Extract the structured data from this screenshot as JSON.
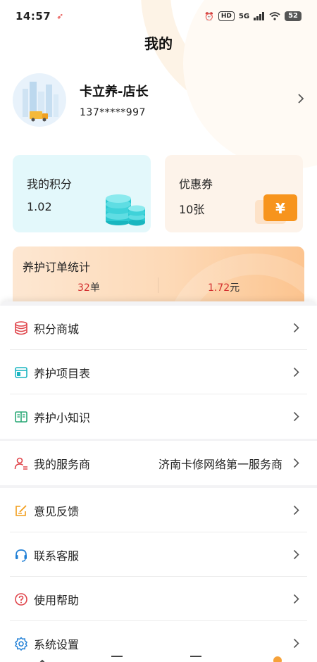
{
  "status_bar": {
    "time": "14:57",
    "hd_label": "HD",
    "network": "5G",
    "battery": "52"
  },
  "header": {
    "title": "我的"
  },
  "profile": {
    "name": "卡立养-店长",
    "phone": "137*****997"
  },
  "cards": {
    "points": {
      "label": "我的积分",
      "value": "1.02"
    },
    "coupon": {
      "label": "优惠券",
      "value": "10张",
      "icon_symbol": "¥"
    }
  },
  "orders": {
    "title": "养护订单统计",
    "count_value": "32",
    "count_unit": "单",
    "amount_value": "1.72",
    "amount_unit": "元"
  },
  "menu": {
    "group1": [
      {
        "label": "积分商城",
        "icon": "database-icon"
      },
      {
        "label": "养护项目表",
        "icon": "window-icon"
      },
      {
        "label": "养护小知识",
        "icon": "book-icon"
      }
    ],
    "group2": [
      {
        "label": "我的服务商",
        "value": "济南卡修网络第一服务商",
        "icon": "user-list-icon"
      }
    ],
    "group3": [
      {
        "label": "意见反馈",
        "icon": "edit-icon"
      },
      {
        "label": "联系客服",
        "icon": "headset-icon"
      },
      {
        "label": "使用帮助",
        "icon": "help-icon"
      },
      {
        "label": "系统设置",
        "icon": "gear-icon"
      }
    ]
  },
  "colors": {
    "accent_orange": "#f6a23a",
    "amount_red": "#d32f2f",
    "points_card_bg": "#e3f8fb",
    "coupon_card_bg": "#fdf3ea"
  }
}
